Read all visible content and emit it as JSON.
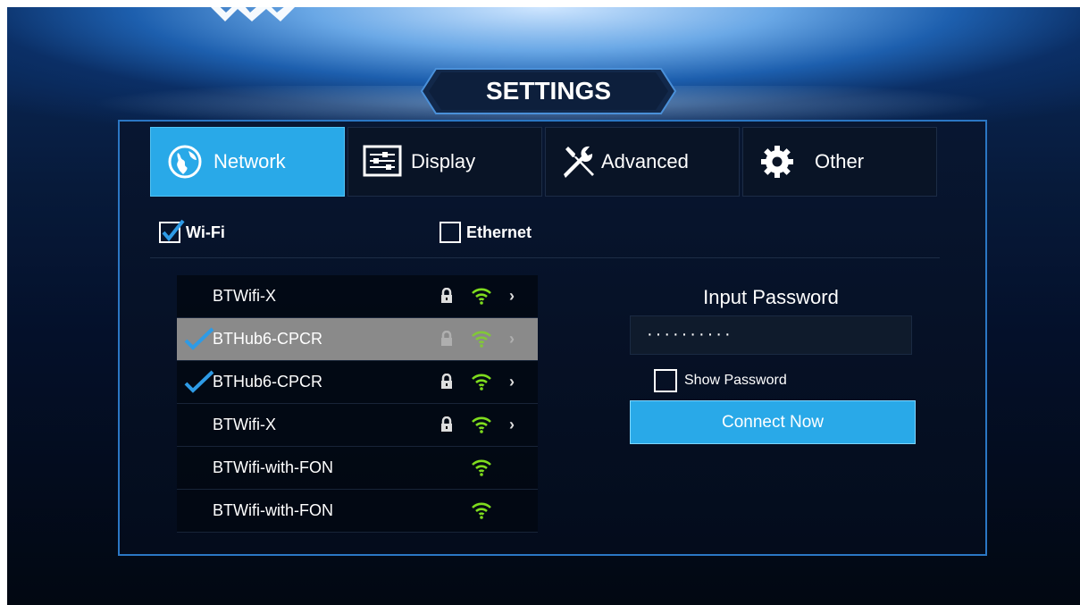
{
  "title": "SETTINGS",
  "tabs": [
    {
      "label": "Network",
      "icon": "globe-icon",
      "active": true
    },
    {
      "label": "Display",
      "icon": "sliders-icon",
      "active": false
    },
    {
      "label": "Advanced",
      "icon": "tools-icon",
      "active": false
    },
    {
      "label": "Other",
      "icon": "gear-icon",
      "active": false
    }
  ],
  "connection_types": {
    "wifi": {
      "label": "Wi-Fi",
      "checked": true
    },
    "ethernet": {
      "label": "Ethernet",
      "checked": false
    }
  },
  "networks": [
    {
      "name": "BTWifi-X",
      "connected": false,
      "secured": true,
      "selected": false
    },
    {
      "name": "BTHub6-CPCR",
      "connected": true,
      "secured": true,
      "selected": true
    },
    {
      "name": "BTHub6-CPCR",
      "connected": true,
      "secured": true,
      "selected": false
    },
    {
      "name": "BTWifi-X",
      "connected": false,
      "secured": true,
      "selected": false
    },
    {
      "name": "BTWifi-with-FON",
      "connected": false,
      "secured": false,
      "selected": false
    },
    {
      "name": "BTWifi-with-FON",
      "connected": false,
      "secured": false,
      "selected": false
    }
  ],
  "password": {
    "title": "Input Password",
    "value": "··········",
    "show_label": "Show Password",
    "show_checked": false
  },
  "connect_label": "Connect Now",
  "colors": {
    "accent": "#29a9e8",
    "signal": "#7fdc1e",
    "check": "#2e9be6"
  }
}
